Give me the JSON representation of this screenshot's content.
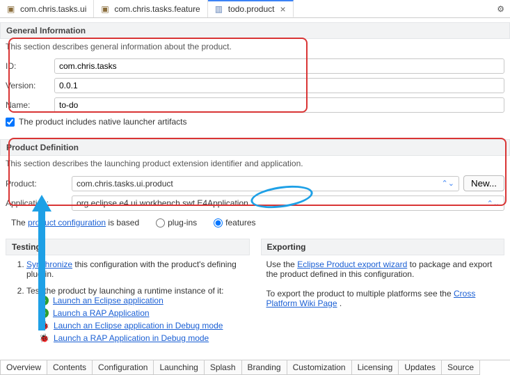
{
  "tabs": [
    {
      "label": "com.chris.tasks.ui"
    },
    {
      "label": "com.chris.tasks.feature"
    },
    {
      "label": "todo.product"
    }
  ],
  "general": {
    "title": "General Information",
    "desc": "This section describes general information about the product.",
    "id_lbl": "ID:",
    "id_val": "com.chris.tasks",
    "ver_lbl": "Version:",
    "ver_val": "0.0.1",
    "name_lbl": "Name:",
    "name_val": "to-do",
    "check_lbl": "The product includes native launcher artifacts"
  },
  "proddef": {
    "title": "Product Definition",
    "desc": "This section describes the launching product extension identifier and application.",
    "prod_lbl": "Product:",
    "prod_val": "com.chris.tasks.ui.product",
    "new_btn": "New...",
    "app_lbl": "Application:",
    "app_val": "org.eclipse.e4.ui.workbench.swt.E4Application",
    "based_pre": "The ",
    "based_link": "product configuration",
    "based_post": " is based",
    "opt_plugins": "plug-ins",
    "opt_features": "features"
  },
  "testing": {
    "title": "Testing",
    "li1_link": "Synchronize",
    "li1_post": " this configuration with the product's defining plug-in.",
    "li2": "Test the product by launching a runtime instance of it:",
    "l1": "Launch an Eclipse application",
    "l2": "Launch a RAP Application",
    "l3": "Launch an Eclipse application in Debug mode",
    "l4": "Launch a RAP Application in Debug mode"
  },
  "exporting": {
    "title": "Exporting",
    "p1_pre": "Use the ",
    "p1_link": "Eclipse Product export wizard",
    "p1_post": " to package and export the product defined in this configuration.",
    "p2_pre": "To export the product to multiple platforms see the  ",
    "p2_link": "Cross Platform Wiki Page",
    "p2_post": " ."
  },
  "bottom_tabs": [
    "Overview",
    "Contents",
    "Configuration",
    "Launching",
    "Splash",
    "Branding",
    "Customization",
    "Licensing",
    "Updates",
    "Source"
  ]
}
